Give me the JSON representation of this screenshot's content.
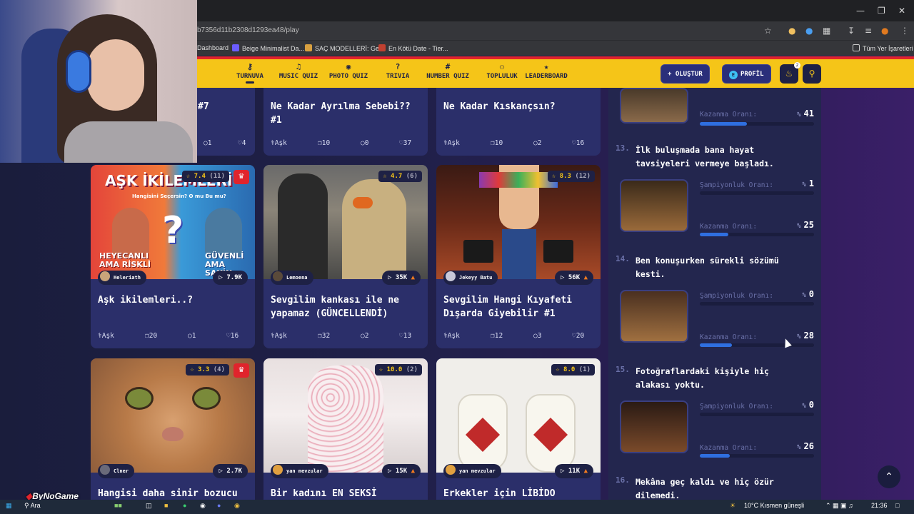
{
  "browser": {
    "url": "b7356d11b2308d1293ea48/play",
    "bookmarks": [
      "Dashboard",
      "Beige Minimalist Da...",
      "SAÇ MODELLERİ: Ge...",
      "En Kötü Date - Tier..."
    ],
    "all_bookmarks": "Tüm Yer İşaretleri"
  },
  "nav": {
    "items": [
      {
        "label": "TURNUVA",
        "icon": "trophy-icon"
      },
      {
        "label": "MUSIC QUIZ",
        "icon": "music-icon"
      },
      {
        "label": "PHOTO QUIZ",
        "icon": "camera-icon"
      },
      {
        "label": "TRIVIA",
        "icon": "question-icon"
      },
      {
        "label": "NUMBER QUIZ",
        "icon": "hash-icon"
      },
      {
        "label": "TOPLULUK",
        "icon": "users-icon"
      },
      {
        "label": "LEADERBOARD",
        "icon": "medal-icon"
      }
    ],
    "create": "OLUŞTUR",
    "profile_initial": "E",
    "profile": "PROFİL",
    "notif_count": "2"
  },
  "top_cards": [
    {
      "title": "#7",
      "stats": [
        "1",
        "4"
      ]
    },
    {
      "title": "Ne Kadar Ayrılma Sebebi?? #1",
      "category": "Aşk",
      "questions": "10",
      "comments": "0",
      "likes": "37"
    },
    {
      "title": "Ne Kadar Kıskançsın?",
      "category": "Aşk",
      "questions": "10",
      "comments": "2",
      "likes": "16"
    }
  ],
  "cards": [
    {
      "rating": "7.4",
      "count": "(11)",
      "crown": true,
      "author": "Heleriath",
      "plays": "7.9K",
      "hot": false,
      "title": "Aşk ikilemleri..?",
      "category": "Aşk",
      "questions": "20",
      "comments": "1",
      "likes": "16",
      "img_text": [
        "AŞK İKİLEMLERİ",
        "Hangisini Seçersin? O mu Bu mu?",
        "HEYECANLI",
        "AMA RİSKLİ",
        "GÜVENLİ",
        "AMA SAKİN"
      ]
    },
    {
      "rating": "4.7",
      "count": "(6)",
      "crown": false,
      "author": "Lemoena",
      "plays": "35K",
      "hot": true,
      "title": "Sevgilim kankası ile ne yapamaz (GÜNCELLENDİ)",
      "category": "Aşk",
      "questions": "32",
      "comments": "2",
      "likes": "13"
    },
    {
      "rating": "8.3",
      "count": "(12)",
      "crown": false,
      "author": "Jekeyy Batu",
      "plays": "56K",
      "hot": true,
      "title": "Sevgilim Hangi Kıyafeti Dışarda Giyebilir #1",
      "category": "Aşk",
      "questions": "12",
      "comments": "3",
      "likes": "20"
    },
    {
      "rating": "3.3",
      "count": "(4)",
      "crown": true,
      "author": "Clner",
      "plays": "2.7K",
      "hot": false,
      "title": "Hangisi daha sinir bozucu"
    },
    {
      "rating": "10.0",
      "count": "(2)",
      "crown": false,
      "author": "yan mevzular",
      "plays": "15K",
      "hot": true,
      "title": "Bir kadını EN SEKSİ"
    },
    {
      "rating": "8.0",
      "count": "(1)",
      "crown": false,
      "author": "yan mevzular",
      "plays": "11K",
      "hot": true,
      "title": "Erkekler için LİBİDO"
    }
  ],
  "panel": {
    "win_rate_label": "Kazanma Oranı:",
    "champ_label": "Şampiyonluk Oranı:",
    "pct_sign": "%",
    "top": {
      "win": "41",
      "win_frac": 0.41
    },
    "items": [
      {
        "num": "13.",
        "title": "İlk buluşmada bana hayat tavsiyeleri vermeye başladı.",
        "champ": "1",
        "win": "25",
        "win_frac": 0.25
      },
      {
        "num": "14.",
        "title": "Ben konuşurken sürekli sözümü kesti.",
        "champ": "0",
        "win": "28",
        "win_frac": 0.28
      },
      {
        "num": "15.",
        "title": "Fotoğraflardaki kişiyle hiç alakası yoktu.",
        "champ": "0",
        "win": "26",
        "win_frac": 0.26
      },
      {
        "num": "16.",
        "title": "Mekâna geç kaldı ve hiç özür dilemedi."
      }
    ]
  },
  "watermark": "ByNoGame",
  "taskbar": {
    "search": "Ara",
    "weather": "10°C  Kısmen güneşli",
    "time": "21:36"
  }
}
